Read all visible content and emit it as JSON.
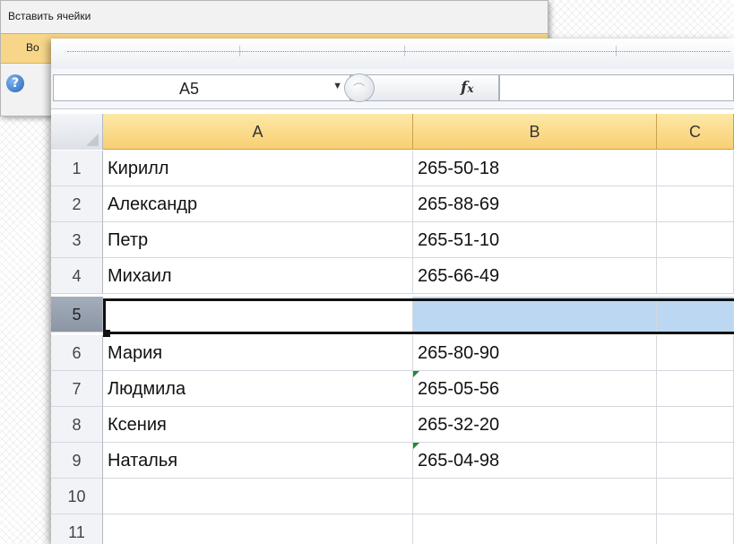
{
  "dialog": {
    "title": "Вставить ячейки",
    "option_label": "Во",
    "help_icon": "help-icon"
  },
  "name_box": {
    "value": "A5"
  },
  "formula_bar": {
    "fx_label": "fx",
    "value": ""
  },
  "columns": [
    "A",
    "B",
    "C"
  ],
  "rows": [
    {
      "num": "1",
      "a": "Кирилл",
      "b": "265-50-18"
    },
    {
      "num": "2",
      "a": "Александр",
      "b": "265-88-69"
    },
    {
      "num": "3",
      "a": "Петр",
      "b": "265-51-10"
    },
    {
      "num": "4",
      "a": "Михаил",
      "b": "265-66-49"
    },
    {
      "num": "5",
      "a": "",
      "b": ""
    },
    {
      "num": "6",
      "a": "Мария",
      "b": "265-80-90"
    },
    {
      "num": "7",
      "a": "Людмила",
      "b": "265-05-56"
    },
    {
      "num": "8",
      "a": "Ксения",
      "b": "265-32-20"
    },
    {
      "num": "9",
      "a": "Наталья",
      "b": "265-04-98"
    },
    {
      "num": "10",
      "a": "",
      "b": ""
    },
    {
      "num": "11",
      "a": "",
      "b": ""
    }
  ],
  "colors": {
    "header_fill": "#f9cf72",
    "selection_fill": "#bcd7f1",
    "text_marker": "#1e8a2e"
  }
}
